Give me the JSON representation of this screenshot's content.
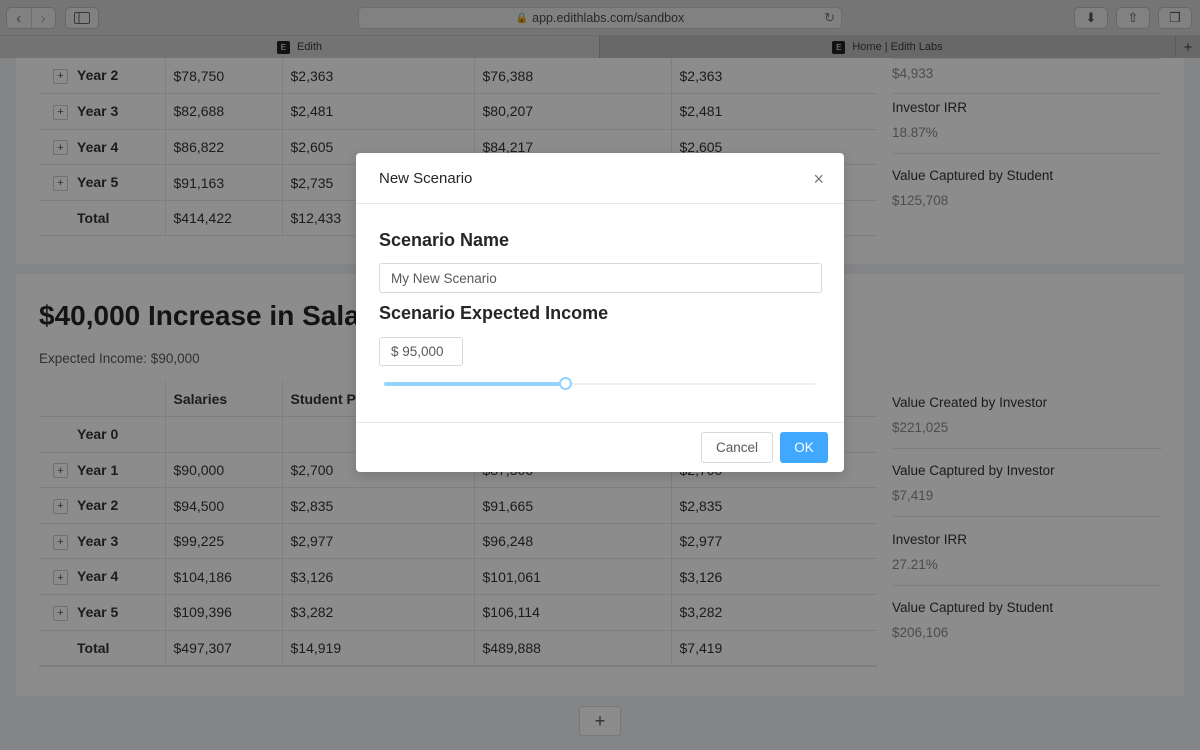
{
  "browser": {
    "url": "app.edithlabs.com/sandbox",
    "tabs": [
      {
        "label": "Edith",
        "favicon": "E",
        "active": true
      },
      {
        "label": "Home | Edith Labs",
        "favicon": "E",
        "active": false
      }
    ],
    "icons": [
      "back-icon",
      "forward-icon",
      "sidebar-icon",
      "lock-icon",
      "reload-icon",
      "download-icon",
      "share-icon",
      "tabs-overview-icon",
      "new-tab-icon"
    ]
  },
  "scenario1": {
    "rows": [
      {
        "label": "Year 2",
        "c1": "$78,750",
        "c2": "$2,363",
        "c3": "$76,388",
        "c4": "$2,363",
        "expandable": true
      },
      {
        "label": "Year 3",
        "c1": "$82,688",
        "c2": "$2,481",
        "c3": "$80,207",
        "c4": "$2,481",
        "expandable": true
      },
      {
        "label": "Year 4",
        "c1": "$86,822",
        "c2": "$2,605",
        "c3": "$84,217",
        "c4": "$2,605",
        "expandable": true
      },
      {
        "label": "Year 5",
        "c1": "$91,163",
        "c2": "$2,735",
        "c3": "",
        "c4": "",
        "expandable": true
      },
      {
        "label": "Total",
        "c1": "$414,422",
        "c2": "$12,433",
        "c3": "",
        "c4": "",
        "expandable": false
      }
    ],
    "metrics": [
      {
        "label": "",
        "value": "$4,933"
      },
      {
        "label": "Investor IRR",
        "value": "18.87%"
      },
      {
        "label": "Value Captured by Student",
        "value": "$125,708"
      }
    ]
  },
  "scenario2": {
    "title": "$40,000 Increase in Sala",
    "expected_income": "Expected Income: $90,000",
    "headers": [
      "",
      "Salaries",
      "Student Pa",
      "",
      ""
    ],
    "rows": [
      {
        "label": "Year 0",
        "c1": "",
        "c2": "",
        "c3": "",
        "c4": "",
        "expandable": false
      },
      {
        "label": "Year 1",
        "c1": "$90,000",
        "c2": "$2,700",
        "c3": "$87,300",
        "c4": "$2,700",
        "expandable": true
      },
      {
        "label": "Year 2",
        "c1": "$94,500",
        "c2": "$2,835",
        "c3": "$91,665",
        "c4": "$2,835",
        "expandable": true
      },
      {
        "label": "Year 3",
        "c1": "$99,225",
        "c2": "$2,977",
        "c3": "$96,248",
        "c4": "$2,977",
        "expandable": true
      },
      {
        "label": "Year 4",
        "c1": "$104,186",
        "c2": "$3,126",
        "c3": "$101,061",
        "c4": "$3,126",
        "expandable": true
      },
      {
        "label": "Year 5",
        "c1": "$109,396",
        "c2": "$3,282",
        "c3": "$106,114",
        "c4": "$3,282",
        "expandable": true
      },
      {
        "label": "Total",
        "c1": "$497,307",
        "c2": "$14,919",
        "c3": "$489,888",
        "c4": "$7,419",
        "expandable": false
      }
    ],
    "metrics": [
      {
        "label": "Value Created by Investor",
        "value": "$221,025"
      },
      {
        "label": "Value Captured by Investor",
        "value": "$7,419"
      },
      {
        "label": "Investor IRR",
        "value": "27.21%"
      },
      {
        "label": "Value Captured by Student",
        "value": "$206,106"
      }
    ]
  },
  "add_button": "+",
  "modal": {
    "title": "New Scenario",
    "close": "×",
    "name_label": "Scenario Name",
    "name_value": "My New Scenario",
    "income_label": "Scenario Expected Income",
    "income_value": "$ 95,000",
    "slider_fraction": 0.42,
    "cancel_label": "Cancel",
    "ok_label": "OK",
    "accent": "#40a9ff"
  }
}
